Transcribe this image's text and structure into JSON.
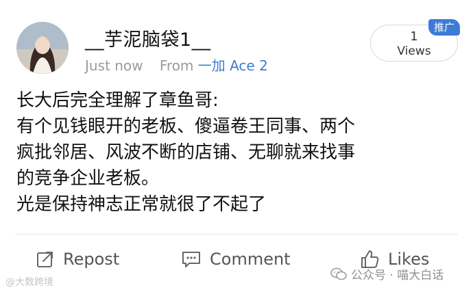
{
  "post": {
    "username": "__芋泥脑袋1__",
    "time": "Just now",
    "from_label": "From",
    "device": "一加 Ace 2",
    "views_count": "1",
    "views_label": "Views",
    "promo_badge": "推广",
    "content_lines": [
      "长大后完全理解了章鱼哥:",
      "有个见钱眼开的老板、傻逼卷王同事、两个",
      "疯批邻居、风波不断的店铺、无聊就来找事",
      "的竞争企业老板。",
      "光是保持神志正常就很了不起了"
    ]
  },
  "actions": {
    "repost_label": "Repost",
    "comment_label": "Comment",
    "likes_label": "Likes"
  },
  "watermarks": {
    "left": "@大数跨境",
    "right": "公众号 · 喵大白话"
  },
  "colors": {
    "accent": "#3d7bd6",
    "meta_text": "#9a9a9a",
    "action_text": "#555555"
  },
  "icons": [
    "repost-icon",
    "comment-icon",
    "like-icon",
    "wechat-icon"
  ]
}
